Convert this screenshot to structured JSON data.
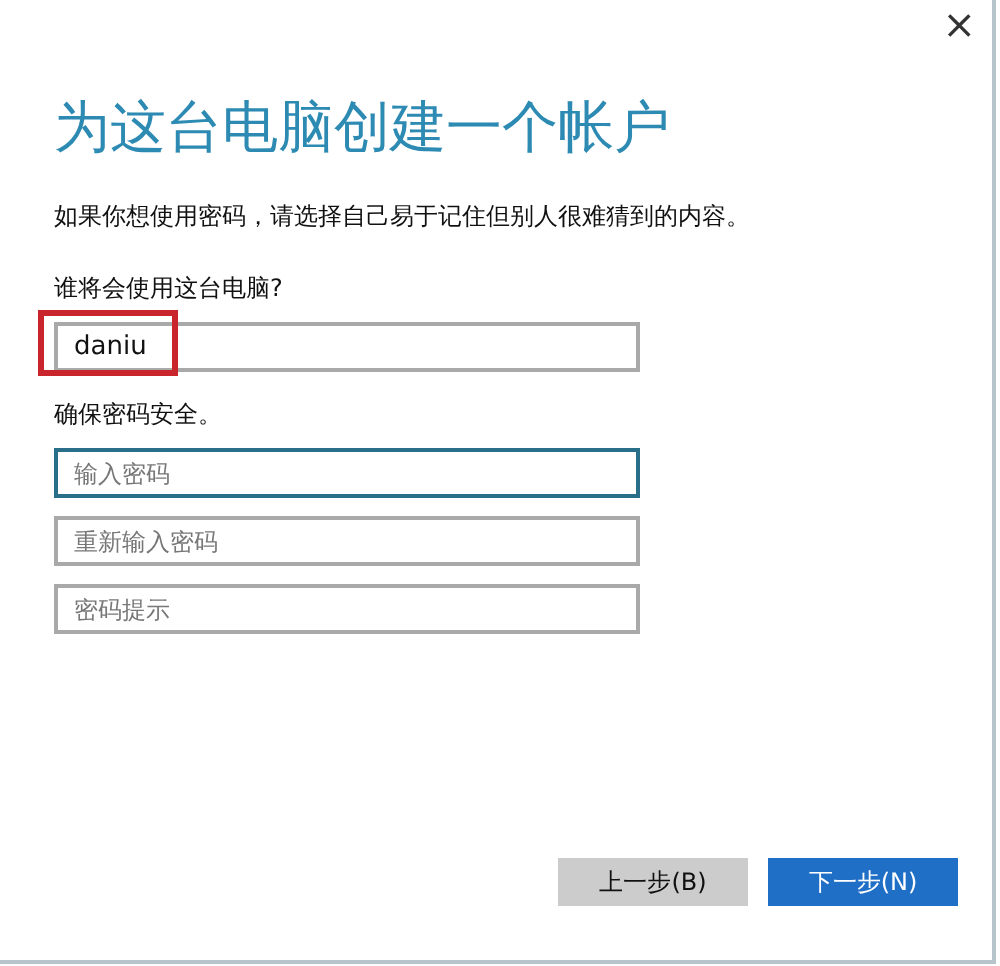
{
  "window": {
    "close": "×"
  },
  "title": "为这台电脑创建一个帐户",
  "intro": "如果你想使用密码，请选择自己易于记住但别人很难猜到的内容。",
  "user_label": "谁将会使用这台电脑?",
  "username": {
    "value": "daniu",
    "highlighted": true
  },
  "password_label": "确保密码安全。",
  "password_fields": [
    {
      "placeholder": "输入密码",
      "focused": true
    },
    {
      "placeholder": "重新输入密码",
      "focused": false
    },
    {
      "placeholder": "密码提示",
      "focused": false
    }
  ],
  "buttons": [
    {
      "label": "上一步(B)",
      "kind": "secondary"
    },
    {
      "label": "下一步(N)",
      "kind": "primary"
    }
  ]
}
